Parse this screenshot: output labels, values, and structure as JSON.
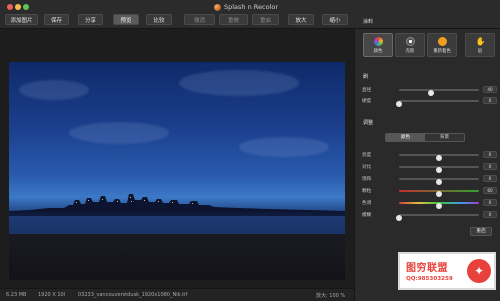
{
  "window": {
    "title": "Splash n Recolor"
  },
  "toolbar": {
    "add_image": "添加图片",
    "save": "保存",
    "share": "分享",
    "preview": "预览",
    "compare": "比较",
    "undo": "撤消",
    "redo": "重做",
    "reset": "重启",
    "zoom_in": "放大",
    "zoom_out": "缩小"
  },
  "status": {
    "file_size": "6.23 MB",
    "dimensions": "1920 X 10l",
    "filename": "03233_vancouverstdusk_1920x1080_Nik.tif",
    "zoom": "放大: 100 %"
  },
  "panel": {
    "tools_title": "涂料",
    "tools": [
      {
        "label": "颜色",
        "icon": "color-wheel-icon"
      },
      {
        "label": "克斯",
        "icon": "light-icon"
      },
      {
        "label": "重新着色",
        "icon": "recolor-icon"
      },
      {
        "label": "层",
        "icon": "hand-icon"
      }
    ],
    "brush_title": "刷",
    "brush_sliders": [
      {
        "label": "直径",
        "value": "40",
        "fraction": 0.4
      },
      {
        "label": "硬度",
        "value": "0",
        "fraction": 0.0
      }
    ],
    "adjust_title": "调整",
    "segment": {
      "left": "颜色",
      "right": "背景",
      "selected": "颜色"
    },
    "adjust_sliders": [
      {
        "label": "亮度",
        "value": "0",
        "fraction": 0.5
      },
      {
        "label": "对比",
        "value": "0",
        "fraction": 0.5
      },
      {
        "label": "饱和",
        "value": "0",
        "fraction": 0.5
      },
      {
        "label": "颗粒",
        "value": "60",
        "fraction": 0.5
      },
      {
        "label": "色调",
        "value": "0",
        "fraction": 0.5
      },
      {
        "label": "模糊",
        "value": "0",
        "fraction": 0.0
      }
    ],
    "reset_label": "重启"
  },
  "watermark": {
    "title": "图穷联盟",
    "qq": "QQ:985303259"
  }
}
